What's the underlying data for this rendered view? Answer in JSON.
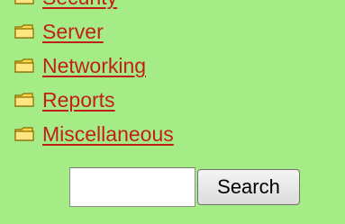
{
  "colors": {
    "background": "#a6ec86",
    "link": "#c0201a",
    "folder_fill": "#ffd84a",
    "folder_outline": "#8a6a00"
  },
  "categories": [
    {
      "label": "Security",
      "icon": "folder-icon"
    },
    {
      "label": "Server",
      "icon": "folder-icon"
    },
    {
      "label": "Networking",
      "icon": "folder-icon"
    },
    {
      "label": "Reports",
      "icon": "folder-icon"
    },
    {
      "label": "Miscellaneous",
      "icon": "folder-icon"
    }
  ],
  "search": {
    "value": "",
    "button_label": "Search"
  }
}
